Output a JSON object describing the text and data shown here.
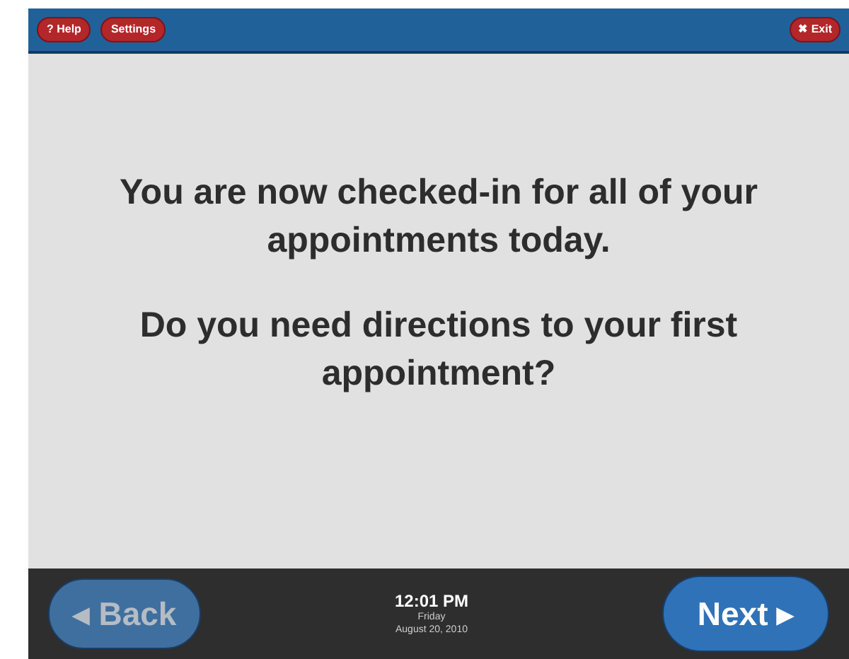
{
  "top_bar": {
    "left_buttons": [
      {
        "label": "? Help"
      },
      {
        "label": "Settings"
      }
    ],
    "exit_button": {
      "label": "✖ Exit"
    }
  },
  "message": [
    "You are now checked-in for all of your appointments today.",
    "Do you need directions to your first appointment?"
  ],
  "bottom_bar": {
    "back_button": {
      "label": "◂ Back",
      "disabled": true
    },
    "time": "12:01 PM",
    "day": "Friday",
    "date": "August 20, 2010",
    "next_button": {
      "label": "Next ▸",
      "disabled": false
    }
  }
}
